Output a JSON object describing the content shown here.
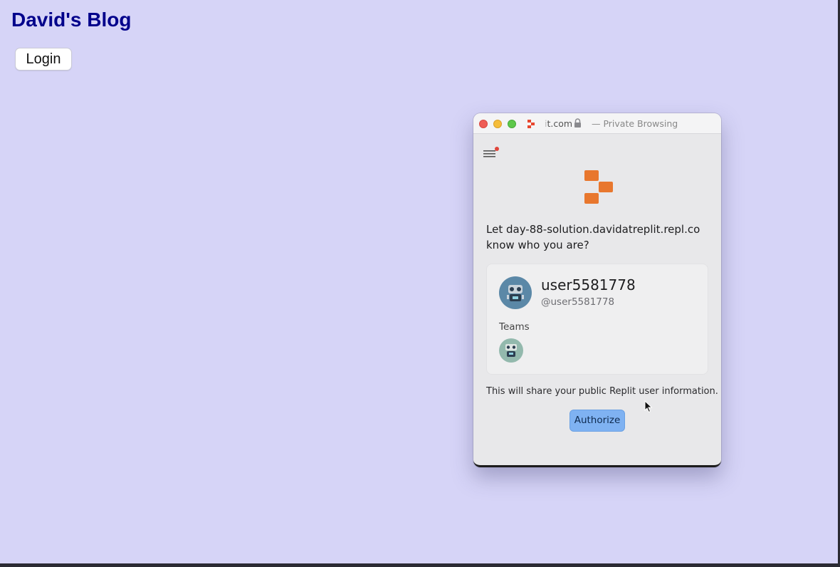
{
  "blog": {
    "title": "David's Blog",
    "login_label": "Login"
  },
  "popup_window": {
    "titlebar": {
      "url_faded": "i",
      "url": "t.com",
      "mode": "— Private Browsing"
    },
    "prompt_prefix": "Let ",
    "prompt_domain": "day-88-solution.davidatreplit.repl.co",
    "prompt_suffix": "know who you are?",
    "user": {
      "username": "user5581778",
      "handle": "@user5581778"
    },
    "teams_label": "Teams",
    "share_note": "This will share your public Replit user information.",
    "authorize_label": "Authorize"
  },
  "colors": {
    "page_background": "#d6d4f7",
    "blog_title": "#00008b",
    "replit_orange": "#e8772e",
    "authorize_button": "#7fb2f2"
  },
  "icons": [
    "replit-favicon-icon",
    "lock-icon",
    "hamburger-menu-icon",
    "notification-dot-icon",
    "replit-logo-icon",
    "robot-avatar-icon",
    "mouse-cursor-icon"
  ]
}
